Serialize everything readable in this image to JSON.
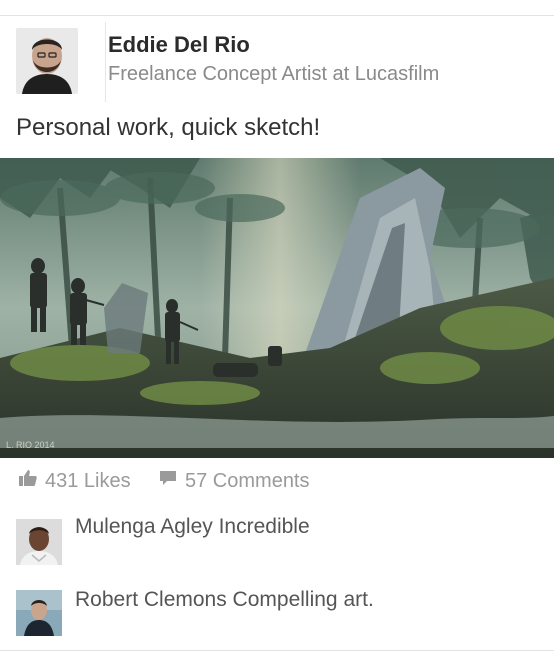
{
  "post": {
    "author_name": "Eddie Del Rio",
    "author_title": "Freelance Concept Artist at Lucasfilm",
    "text": "Personal work, quick sketch!",
    "image_signature": "L. RIO 2014"
  },
  "stats": {
    "likes": "431 Likes",
    "comments": "57 Comments",
    "like_icon": "thumbs-up-icon",
    "comment_icon": "speech-bubble-icon"
  },
  "comments": [
    {
      "text": "Mulenga Agley Incredible"
    },
    {
      "text": "Robert Clemons Compelling art."
    }
  ],
  "colors": {
    "text_dark": "#2b2b2b",
    "text_muted": "#9a9a9a",
    "divider": "#e3e3e3"
  }
}
